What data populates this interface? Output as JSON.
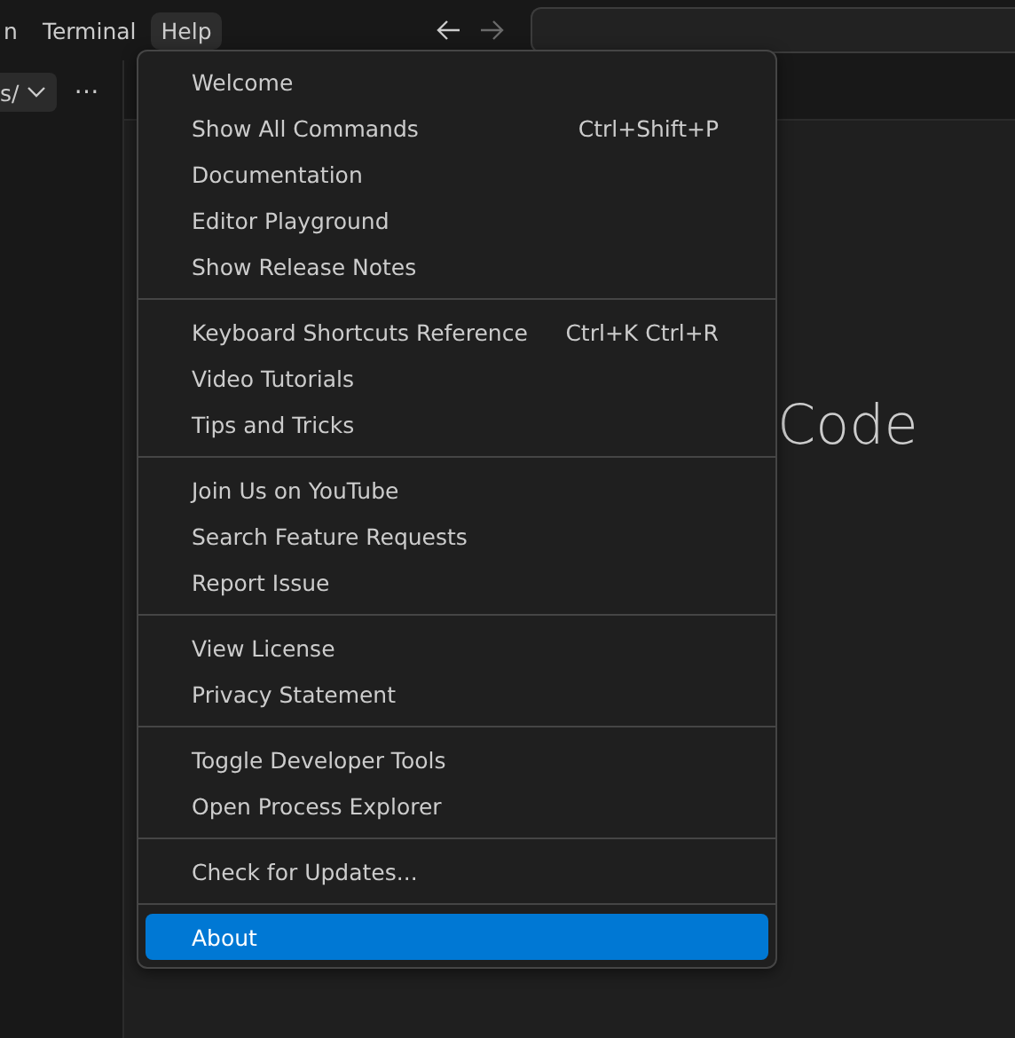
{
  "menubar": [
    {
      "label": "n",
      "selected": false
    },
    {
      "label": "Terminal",
      "selected": false
    },
    {
      "label": "Help",
      "selected": true
    }
  ],
  "navigation": {
    "back_disabled": false,
    "forward_disabled": true
  },
  "sidebar": {
    "dropdown": "s/",
    "more": "⋯"
  },
  "editor": {
    "heading": "Code"
  },
  "help_menu": {
    "groups": [
      [
        {
          "label": "Welcome",
          "selected": false
        },
        {
          "label": "Show All Commands",
          "shortcut": "Ctrl+Shift+P",
          "selected": false
        },
        {
          "label": "Documentation",
          "selected": false
        },
        {
          "label": "Editor Playground",
          "selected": false
        },
        {
          "label": "Show Release Notes",
          "selected": false
        }
      ],
      [
        {
          "label": "Keyboard Shortcuts Reference",
          "shortcut": "Ctrl+K Ctrl+R",
          "selected": false
        },
        {
          "label": "Video Tutorials",
          "selected": false
        },
        {
          "label": "Tips and Tricks",
          "selected": false
        }
      ],
      [
        {
          "label": "Join Us on YouTube",
          "selected": false
        },
        {
          "label": "Search Feature Requests",
          "selected": false
        },
        {
          "label": "Report Issue",
          "selected": false
        }
      ],
      [
        {
          "label": "View License",
          "selected": false
        },
        {
          "label": "Privacy Statement",
          "selected": false
        }
      ],
      [
        {
          "label": "Toggle Developer Tools",
          "selected": false
        },
        {
          "label": "Open Process Explorer",
          "selected": false
        }
      ],
      [
        {
          "label": "Check for Updates...",
          "selected": false
        }
      ],
      [
        {
          "label": "About",
          "selected": true
        }
      ]
    ]
  }
}
